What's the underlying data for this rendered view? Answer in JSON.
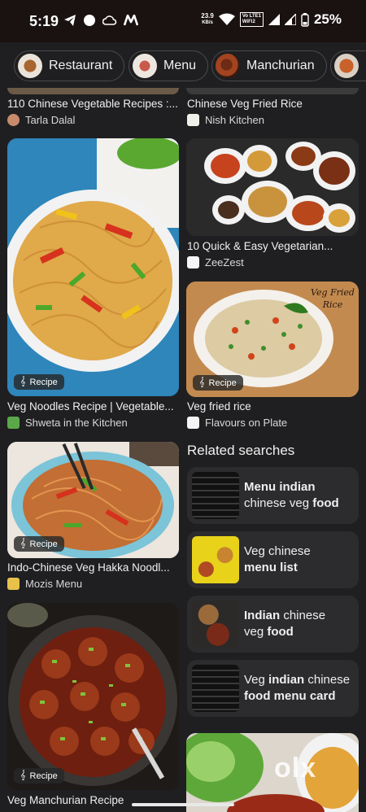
{
  "status": {
    "time": "5:19",
    "speed_value": "23.9",
    "speed_unit": "KB/s",
    "net1": "Vo LTE1",
    "net2": "WiFi2",
    "battery": "25%"
  },
  "chips": [
    {
      "label": "Restaurant"
    },
    {
      "label": "Menu"
    },
    {
      "label": "Manchurian"
    }
  ],
  "results": {
    "r1": {
      "title": "110 Chinese Vegetable Recipes :...",
      "source": "Tarla Dalal"
    },
    "r2": {
      "title": "Chinese Veg Fried Rice",
      "source": "Nish Kitchen"
    },
    "r3": {
      "title": "Veg Noodles Recipe | Vegetable...",
      "source": "Shweta in the Kitchen",
      "badge": "Recipe"
    },
    "r4": {
      "title": "10 Quick & Easy Vegetarian...",
      "source": "ZeeZest"
    },
    "r5": {
      "title": "Veg fried rice",
      "source": "Flavours on Plate",
      "badge": "Recipe",
      "overlay": "Veg Fried Rice"
    },
    "r6": {
      "title": "Indo-Chinese Veg Hakka Noodl...",
      "source": "Mozis Menu",
      "badge": "Recipe"
    },
    "r7": {
      "title": "Veg Manchurian Recipe",
      "badge": "Recipe"
    }
  },
  "related": {
    "heading": "Related searches",
    "items": [
      {
        "b1": "Menu indian",
        "t1": "chinese veg ",
        "b2": "food"
      },
      {
        "t0": "Veg chinese",
        "b1": "menu list"
      },
      {
        "b0": "Indian",
        "t0": " chinese",
        "t1": "veg ",
        "b1": "food"
      },
      {
        "t0": "Veg ",
        "b0": "indian",
        "t1": " chinese",
        "b1": "food menu card"
      }
    ]
  },
  "watermark": "olx",
  "colors": {
    "background": "#1f1f21",
    "card": "#2c2c2e",
    "text": "#f0f0f0"
  }
}
